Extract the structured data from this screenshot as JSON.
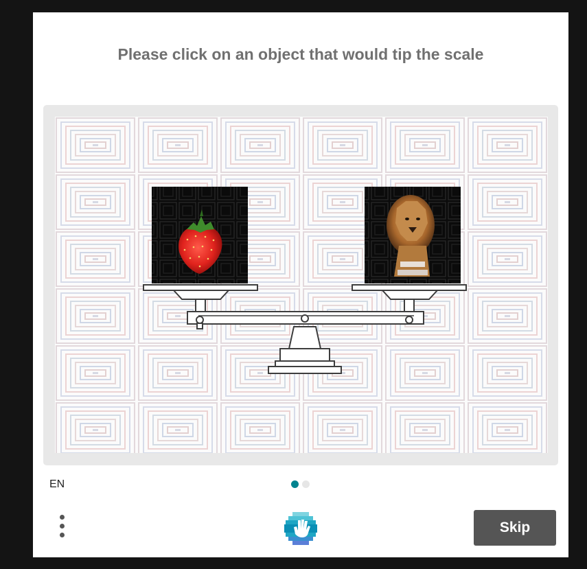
{
  "prompt": "Please click on an object that would tip the scale",
  "language": "EN",
  "skip_label": "Skip",
  "pagination": {
    "total": 2,
    "active": 0
  },
  "options": [
    {
      "name": "strawberry",
      "icon": "strawberry-image"
    },
    {
      "name": "lion",
      "icon": "lion-image"
    }
  ],
  "colors": {
    "accent": "#00838f",
    "inactive_dot": "#e6e6e6",
    "skip_bg": "#555555",
    "prompt_text": "#707070"
  }
}
